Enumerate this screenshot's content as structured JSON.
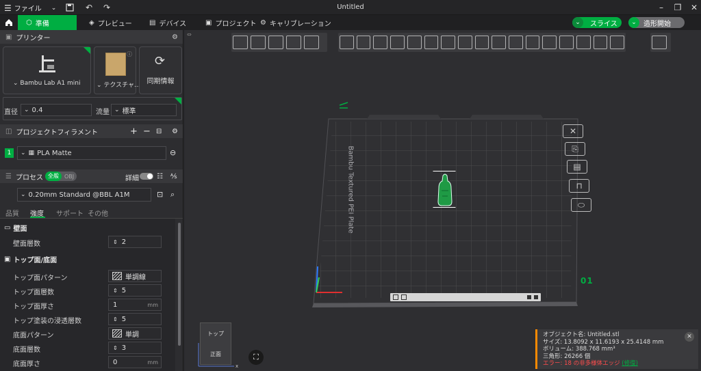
{
  "titlebar": {
    "file_menu": "ファイル",
    "window_title": "Untitled"
  },
  "tabs": [
    {
      "label": "準備"
    },
    {
      "label": "プレビュー"
    },
    {
      "label": "デバイス"
    },
    {
      "label": "プロジェクト"
    },
    {
      "label": "キャリブレーション"
    }
  ],
  "actions": {
    "slice": "スライス",
    "print": "造形開始"
  },
  "printer": {
    "section_title": "プリンター",
    "model": "Bambu Lab A1 mini",
    "plate": "テクスチャ...",
    "sync": "同期情報",
    "nozzle_label": "直径",
    "nozzle_value": "0.4",
    "flow_label": "流量",
    "flow_value": "標準"
  },
  "filament": {
    "section_title": "プロジェクトフィラメント",
    "index": "1",
    "name": "PLA Matte"
  },
  "process": {
    "section_title": "プロセス",
    "toggle_global": "全般",
    "toggle_obj": "OBJ",
    "advanced": "詳細",
    "profile": "0.20mm Standard @BBL A1M",
    "subtabs": [
      "品質",
      "強度",
      "サポート",
      "その他"
    ]
  },
  "walls": {
    "title": "壁面",
    "rows": [
      {
        "label": "壁面層数",
        "value": "2",
        "unit": ""
      }
    ]
  },
  "topbottom": {
    "title": "トップ面/底面",
    "rows": [
      {
        "label": "トップ面パターン",
        "value": "単調線",
        "unit": ""
      },
      {
        "label": "トップ面層数",
        "value": "5",
        "unit": ""
      },
      {
        "label": "トップ面厚さ",
        "value": "1",
        "unit": "mm"
      },
      {
        "label": "トップ塗装の浸透層数",
        "value": "5",
        "unit": ""
      },
      {
        "label": "底面パターン",
        "value": "単調",
        "unit": ""
      },
      {
        "label": "底面層数",
        "value": "3",
        "unit": ""
      },
      {
        "label": "底面厚さ",
        "value": "0",
        "unit": "mm"
      }
    ]
  },
  "plate": {
    "label": "Bambu Textured PEI Plate",
    "number": "01"
  },
  "viewcube": {
    "top": "トップ",
    "front": "正面"
  },
  "object_info": {
    "name": "オブジェクト名: Untitled.stl",
    "size": "サイズ: 13.8092 x 11.6193 x 25.4148 mm",
    "volume": "ボリューム: 388.768 mm³",
    "triangles": "三角形: 26266 個",
    "error_prefix": "エラー: 18 の非多様体エッジ",
    "error_link": "(修復)"
  },
  "colors": {
    "accent": "#00ae42",
    "warning": "#ff8a00",
    "error": "#ff4d4d"
  }
}
